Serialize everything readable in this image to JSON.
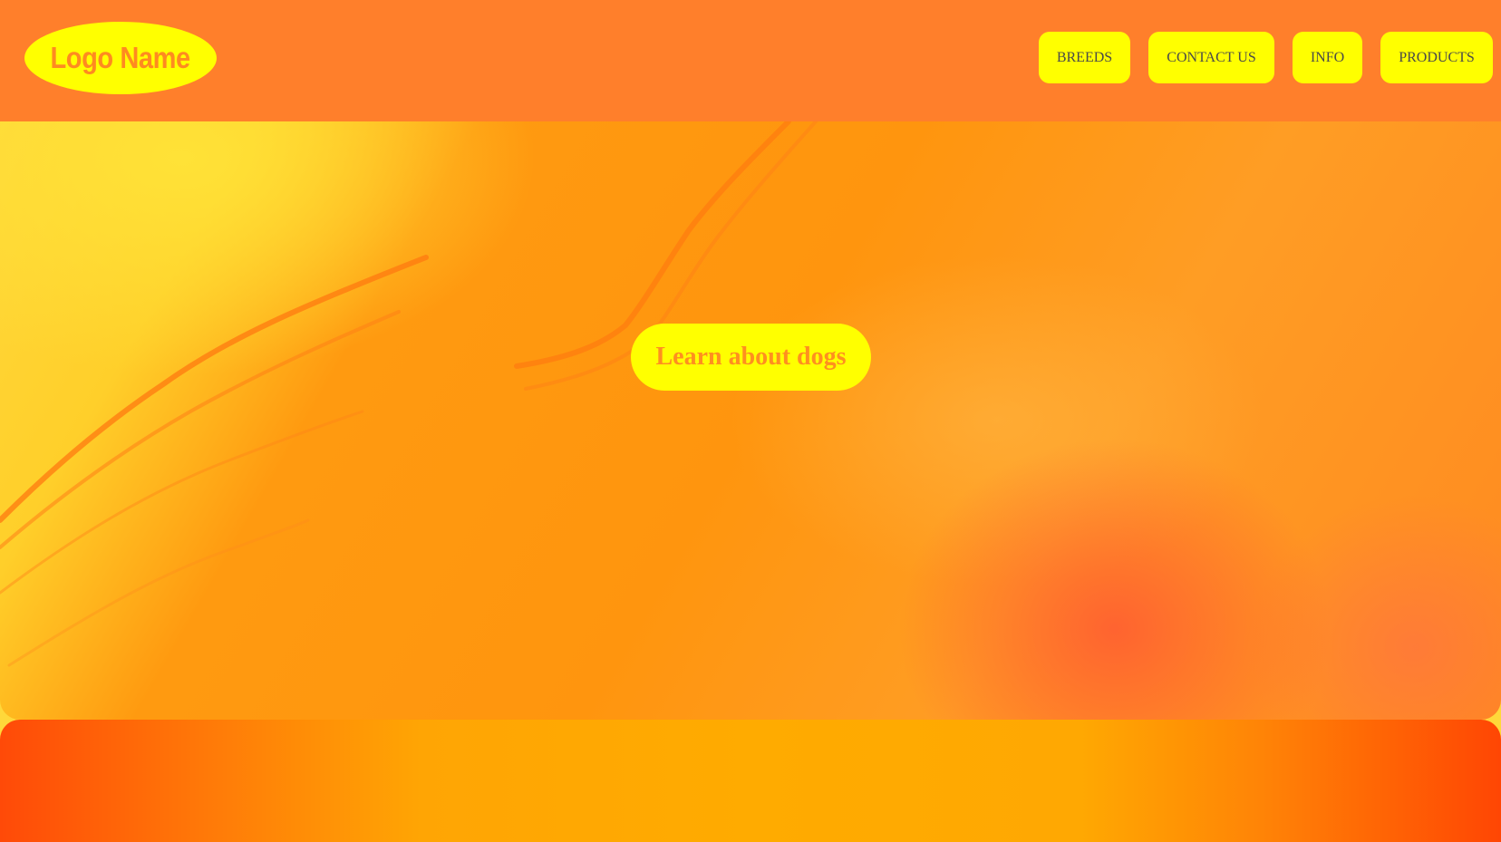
{
  "header": {
    "logo_text": "Logo Name",
    "nav": {
      "breeds": "BREEDS",
      "contact": "CONTACT US",
      "info": "INFO",
      "products": "PRODUCTS"
    }
  },
  "hero": {
    "cta_label": "Learn about dogs"
  },
  "colors": {
    "header_bg": "#ff7f2b",
    "button_bg": "#ffff00",
    "accent_text": "#ff8f1f",
    "nav_text": "#4a4a4a"
  }
}
